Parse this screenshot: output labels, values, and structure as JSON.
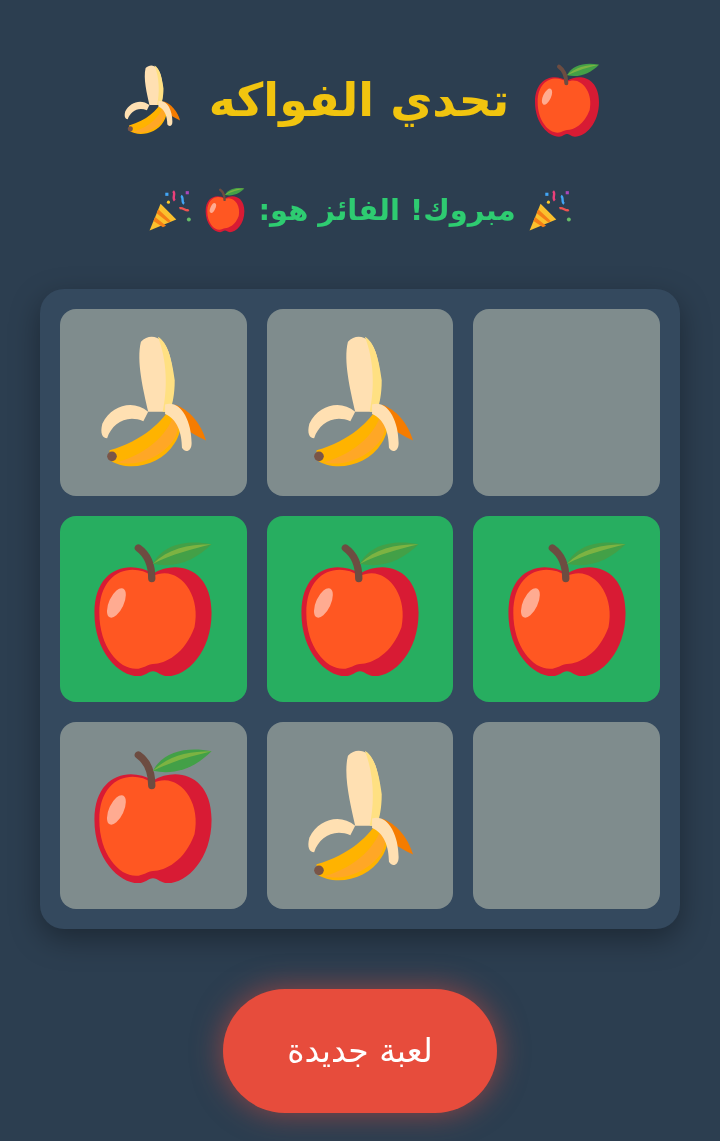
{
  "title": {
    "text": "تحدي الفواكه"
  },
  "status": {
    "text": "مبروك! الفائز هو:",
    "winner": {
      "kind": "apple"
    }
  },
  "board": {
    "cells": [
      {
        "kind": "banana",
        "winning": false
      },
      {
        "kind": "banana",
        "winning": false
      },
      {
        "kind": "empty",
        "winning": false
      },
      {
        "kind": "apple",
        "winning": true
      },
      {
        "kind": "apple",
        "winning": true
      },
      {
        "kind": "apple",
        "winning": true
      },
      {
        "kind": "apple",
        "winning": false
      },
      {
        "kind": "banana",
        "winning": false
      },
      {
        "kind": "empty",
        "winning": false
      }
    ]
  },
  "button": {
    "label": "لعبة جديدة"
  }
}
